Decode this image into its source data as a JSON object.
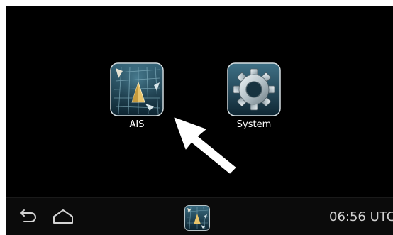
{
  "launcher": {
    "apps": [
      {
        "label": "AIS",
        "icon": "ais-radar-icon"
      },
      {
        "label": "System",
        "icon": "gear-icon"
      }
    ]
  },
  "navbar": {
    "back_icon": "back-arrow-icon",
    "home_icon": "home-icon",
    "pinned_app_icon": "ais-radar-icon",
    "clock": "06:56 UTC"
  },
  "colors": {
    "screen_background": "#000000",
    "page_background": "#ffffff",
    "label_text": "#ffffff",
    "clock_text": "#d0d0d0",
    "radar_grid": "#6fa3b5",
    "gear_metal": "#c9d3d8"
  }
}
